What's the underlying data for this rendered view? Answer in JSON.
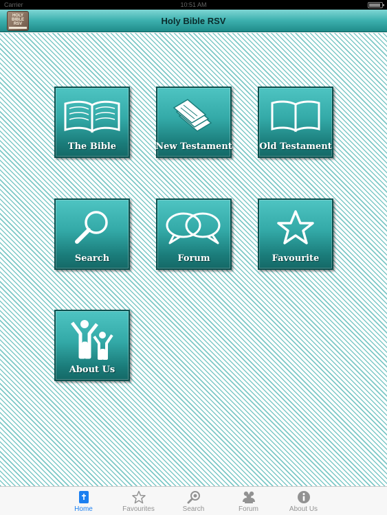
{
  "status_bar": {
    "carrier": "Carrier",
    "time": "10:51 AM"
  },
  "nav": {
    "title": "Holy Bible RSV",
    "logo_lines": [
      "HOLY",
      "BIBLE",
      "RSV"
    ]
  },
  "tiles": [
    {
      "label": "The Bible",
      "icon": "open-book-icon"
    },
    {
      "label": "New Testament",
      "icon": "stacked-pages-icon"
    },
    {
      "label": "Old Testament",
      "icon": "book-outline-icon"
    },
    {
      "label": "Search",
      "icon": "magnifier-icon"
    },
    {
      "label": "Forum",
      "icon": "speech-bubbles-icon"
    },
    {
      "label": "Favourite",
      "icon": "star-icon"
    },
    {
      "label": "About Us",
      "icon": "people-icon"
    }
  ],
  "tabs": [
    {
      "label": "Home",
      "icon": "bible-icon",
      "active": true
    },
    {
      "label": "Favourites",
      "icon": "star-icon"
    },
    {
      "label": "Search",
      "icon": "search-icon"
    },
    {
      "label": "Forum",
      "icon": "users-icon"
    },
    {
      "label": "About Us",
      "icon": "info-icon"
    }
  ],
  "colors": {
    "accent": "#1a7ff0",
    "tile_top": "#4ec4c2",
    "tile_bottom": "#146966",
    "stripe": "#7cc8c6"
  }
}
